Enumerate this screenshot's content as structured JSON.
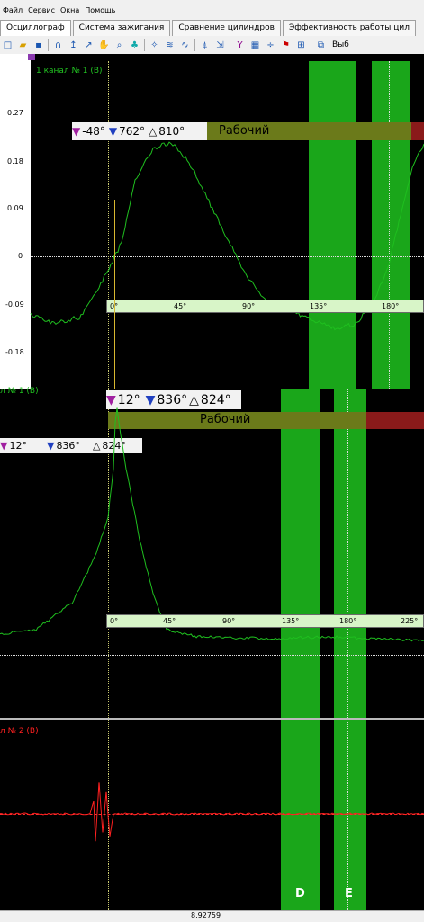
{
  "menu": [
    "Файл",
    "Сервис",
    "Окна",
    "Помощь"
  ],
  "tabs": [
    "Осциллограф",
    "Система зажигания",
    "Сравнение цилиндров",
    "Эффективность работы цил"
  ],
  "toolbar": {
    "right_label": "Выб"
  },
  "panel1": {
    "title": "1  канал № 1 (В)",
    "y_ticks": [
      "0.27",
      "0.18",
      "0.09",
      "0",
      "-0.09",
      "-0.18"
    ],
    "angle_ticks": [
      "0°",
      "45°",
      "90°",
      "135°",
      "180°"
    ],
    "cursor": {
      "left": "-48°",
      "right": "762°",
      "delta": "810°"
    },
    "phase": "Рабочий",
    "waveform_color": "#1fbf1f"
  },
  "panel2": {
    "title": "л № 1 (В)",
    "cursor_top": {
      "left": "12°",
      "right": "836°",
      "delta": "824°"
    },
    "cursor_small": {
      "left": "12°",
      "right": "836°",
      "delta": "824°"
    },
    "phase": "Рабочий",
    "angle_ticks": [
      "0°",
      "45°",
      "90°",
      "135°",
      "180°",
      "225°"
    ]
  },
  "panel3": {
    "title": "л № 2 (В)",
    "waveform_color": "#ff2020"
  },
  "markers": {
    "d": "D",
    "e": "E"
  },
  "status": {
    "value": "8.92759"
  }
}
